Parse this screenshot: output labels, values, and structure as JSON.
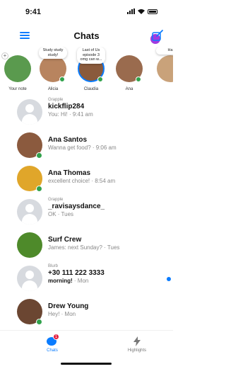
{
  "status_bar": {
    "time": "9:41"
  },
  "header": {
    "title": "Chats"
  },
  "stories": [
    {
      "name": "Your note",
      "bubble": "",
      "avatar_color": "#5a9a4e",
      "ring": false,
      "online": false,
      "plus": "+"
    },
    {
      "name": "Alicia",
      "bubble": "Study study study!",
      "avatar_color": "#b8845f",
      "ring": false,
      "online": true
    },
    {
      "name": "Claudia",
      "bubble": "Last of Us episode 3 omg can w...",
      "avatar_color": "#8a5a3c",
      "ring": true,
      "online": true
    },
    {
      "name": "Ana",
      "bubble": "",
      "avatar_color": "#9a6b4e",
      "ring": false,
      "online": true
    },
    {
      "name": "",
      "bubble": "Ha",
      "avatar_color": "#c9a27a",
      "ring": false,
      "online": false
    }
  ],
  "chats": [
    {
      "source": "Grapple",
      "name": "kickflip284",
      "preview": "You: Hi! · 9:41 am",
      "avatar": "default",
      "online": false,
      "unread": false
    },
    {
      "source": "",
      "name": "Ana Santos",
      "preview": "Wanna get food? · 9:06 am",
      "avatar": "#8b5a3e",
      "online": true,
      "unread": false
    },
    {
      "source": "",
      "name": "Ana Thomas",
      "preview": "excellent choice! · 8:54 am",
      "avatar": "#e0a62a",
      "online": true,
      "unread": false
    },
    {
      "source": "Grapple",
      "name": "_ravisaysdance_",
      "preview": "OK · Tues",
      "avatar": "default",
      "online": false,
      "unread": false
    },
    {
      "source": "",
      "name": "Surf Crew",
      "preview": "James: next Sunday? · Tues",
      "avatar": "#4e8a2a",
      "online": false,
      "unread": false
    },
    {
      "source": "Blurb",
      "name": "+30 111 222 3333",
      "preview_bold": "morning!",
      "preview": " · Mon",
      "avatar": "default",
      "online": false,
      "unread": true
    },
    {
      "source": "",
      "name": "Drew Young",
      "preview": "Hey! · Mon",
      "avatar": "#6b4632",
      "online": true,
      "unread": false
    }
  ],
  "tabs": {
    "chats_label": "Chats",
    "chats_badge": "1",
    "highlights_label": "Highlights"
  },
  "colors": {
    "accent": "#0a7cff",
    "online": "#31a24c",
    "badge": "#e41e3f"
  }
}
